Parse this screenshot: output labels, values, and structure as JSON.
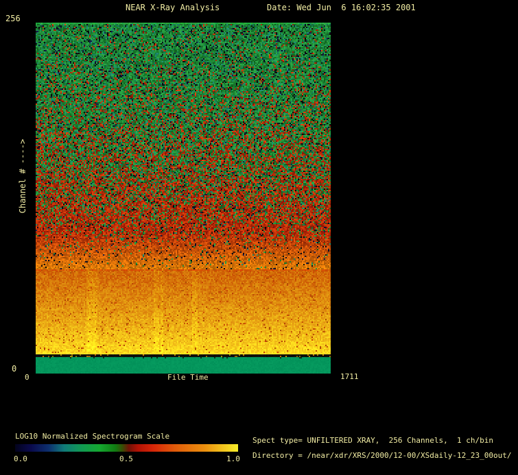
{
  "title": {
    "main": "NEAR X-Ray Analysis",
    "date": "Date: Wed Jun  6 16:02:35 2001"
  },
  "axes": {
    "y_max": "256",
    "y_min": "0",
    "y_label": "Channel # ---->",
    "x_min": "0",
    "x_label": "File Time",
    "x_max": "1711"
  },
  "scale": {
    "label": "LOG10 Normalized Spectrogram Scale",
    "ticks": [
      "0.0",
      "0.5",
      "1.0"
    ]
  },
  "info": {
    "line1": "Spect type= UNFILTERED XRAY,  256 Channels,  1 ch/bin",
    "line2": "Directory = /near/xdr/XRS/2000/12-00/XSdaily-12_23_00out/"
  },
  "colors": {
    "background": "#000000",
    "text": "#f2eda4",
    "footer_band_green": "#009963"
  },
  "chart_data": {
    "type": "heatmap",
    "title": "NEAR X-Ray Analysis",
    "subtitle": "Date: Wed Jun  6 16:02:35 2001",
    "xlabel": "File Time",
    "ylabel": "Channel # ---->",
    "x_range": [
      0,
      1711
    ],
    "y_range": [
      0,
      256
    ],
    "grid": false,
    "legend_position": "none",
    "colorbar": {
      "label": "LOG10 Normalized Spectrogram Scale",
      "ticks": [
        0.0,
        0.5,
        1.0
      ],
      "orientation": "horizontal",
      "gradient": [
        [
          0.0,
          "#03031c"
        ],
        [
          0.07,
          "#0a0a4c"
        ],
        [
          0.15,
          "#0d2f6e"
        ],
        [
          0.22,
          "#107a78"
        ],
        [
          0.3,
          "#119a52"
        ],
        [
          0.38,
          "#15a830"
        ],
        [
          0.45,
          "#117c12"
        ],
        [
          0.48,
          "#365006"
        ],
        [
          0.51,
          "#701206"
        ],
        [
          0.55,
          "#b01205"
        ],
        [
          0.62,
          "#d62608"
        ],
        [
          0.72,
          "#e05c0a"
        ],
        [
          0.85,
          "#eb8f0e"
        ],
        [
          1.0,
          "#f7ef2a"
        ]
      ]
    },
    "bands_top_to_bottom": [
      {
        "y_frac": [
          0.0,
          0.004
        ],
        "desc": "thin bright green line at top edge (channel 256)"
      },
      {
        "y_frac": [
          0.004,
          0.703
        ],
        "desc": "speckled noise fading from green (high channels, ~0.55 normalized) to red (mid channels, ~0.6-0.7), with sparse dark navy/black specks"
      },
      {
        "y_frac": [
          0.703,
          0.945
        ],
        "desc": "bright orange band brightening to yellow toward low channels (~0.8-1.0 normalized), faint lighter vertical streaks"
      },
      {
        "y_frac": [
          0.945,
          0.953
        ],
        "desc": "near-black row with sparse orange specks"
      },
      {
        "y_frac": [
          0.953,
          1.0
        ],
        "desc": "solid emerald green band (#009963) at lowest channels"
      }
    ],
    "spectrogram": {
      "cols": 215,
      "rows": 256,
      "seed": 1337,
      "band_orange_start": 180,
      "band_dark_start": 242,
      "band_green_start": 244,
      "streak_count": 7,
      "palette": {
        "green_lo": [
          14,
          95,
          30
        ],
        "green_hi": [
          45,
          175,
          75
        ],
        "teal_lo": [
          15,
          110,
          85
        ],
        "teal_hi": [
          35,
          150,
          120
        ],
        "red_lo": [
          135,
          18,
          4
        ],
        "red_hi": [
          230,
          70,
          12
        ],
        "dark_lo": [
          2,
          2,
          8
        ],
        "dark_hi": [
          25,
          35,
          90
        ],
        "orange_top": [
          210,
          105,
          8
        ],
        "yellow_bottom": [
          252,
          218,
          30
        ],
        "bottom_green": [
          4,
          150,
          92
        ]
      }
    }
  }
}
